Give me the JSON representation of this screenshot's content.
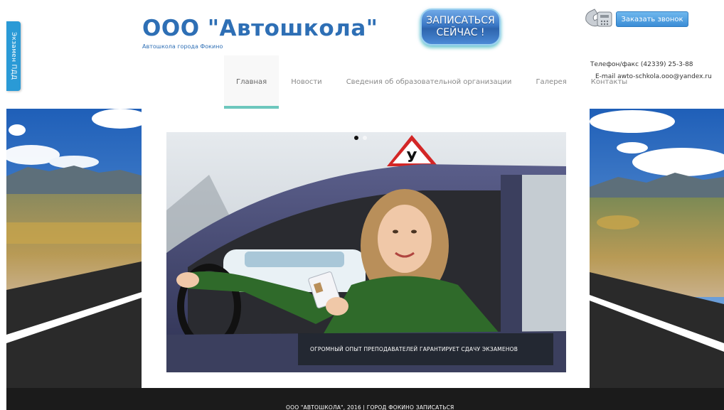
{
  "side_tab": {
    "label": "Экзамен ПДД"
  },
  "brand": {
    "title": "ООО \"Автошкола\"",
    "subtitle": "Автошкола города Фокино"
  },
  "signup_button": {
    "label": "ЗАПИСАТЬСЯ\nСЕЙЧАС !"
  },
  "call_button": {
    "label": "Заказать звонок",
    "icon": "telephone-icon"
  },
  "nav": {
    "items": [
      {
        "label": "Главная",
        "active": true
      },
      {
        "label": "Новости"
      },
      {
        "label": "Сведения об образовательной организации"
      },
      {
        "label": "Галерея"
      },
      {
        "label": "Контакты"
      }
    ]
  },
  "contacts": {
    "phone": "Телефон/факс (42339) 25-3-88",
    "email": "E-mail awto-schkola.ooo@yandex.ru"
  },
  "slider": {
    "image": "woman-in-car-showing-license",
    "sign_letter": "У",
    "caption": "ОГРОМНЫЙ ОПЫТ ПРЕПОДАВАТЕЛЕЙ ГАРАНТИРУЕТ СДАЧУ ЭКЗАМЕНОВ",
    "dots": [
      {
        "active": true
      },
      {
        "active": false
      }
    ]
  },
  "footer": {
    "text": "ООО \"АВТОШКОЛА\", 2016 | ГОРОД ФОКИНО ЗАПИСАТЬСЯ"
  },
  "colors": {
    "brand_blue": "#2e6fb5",
    "nav_active_underline": "#6cc7bd",
    "side_tab": "#2a9ad6",
    "footer_bg": "#1b1b1b"
  }
}
